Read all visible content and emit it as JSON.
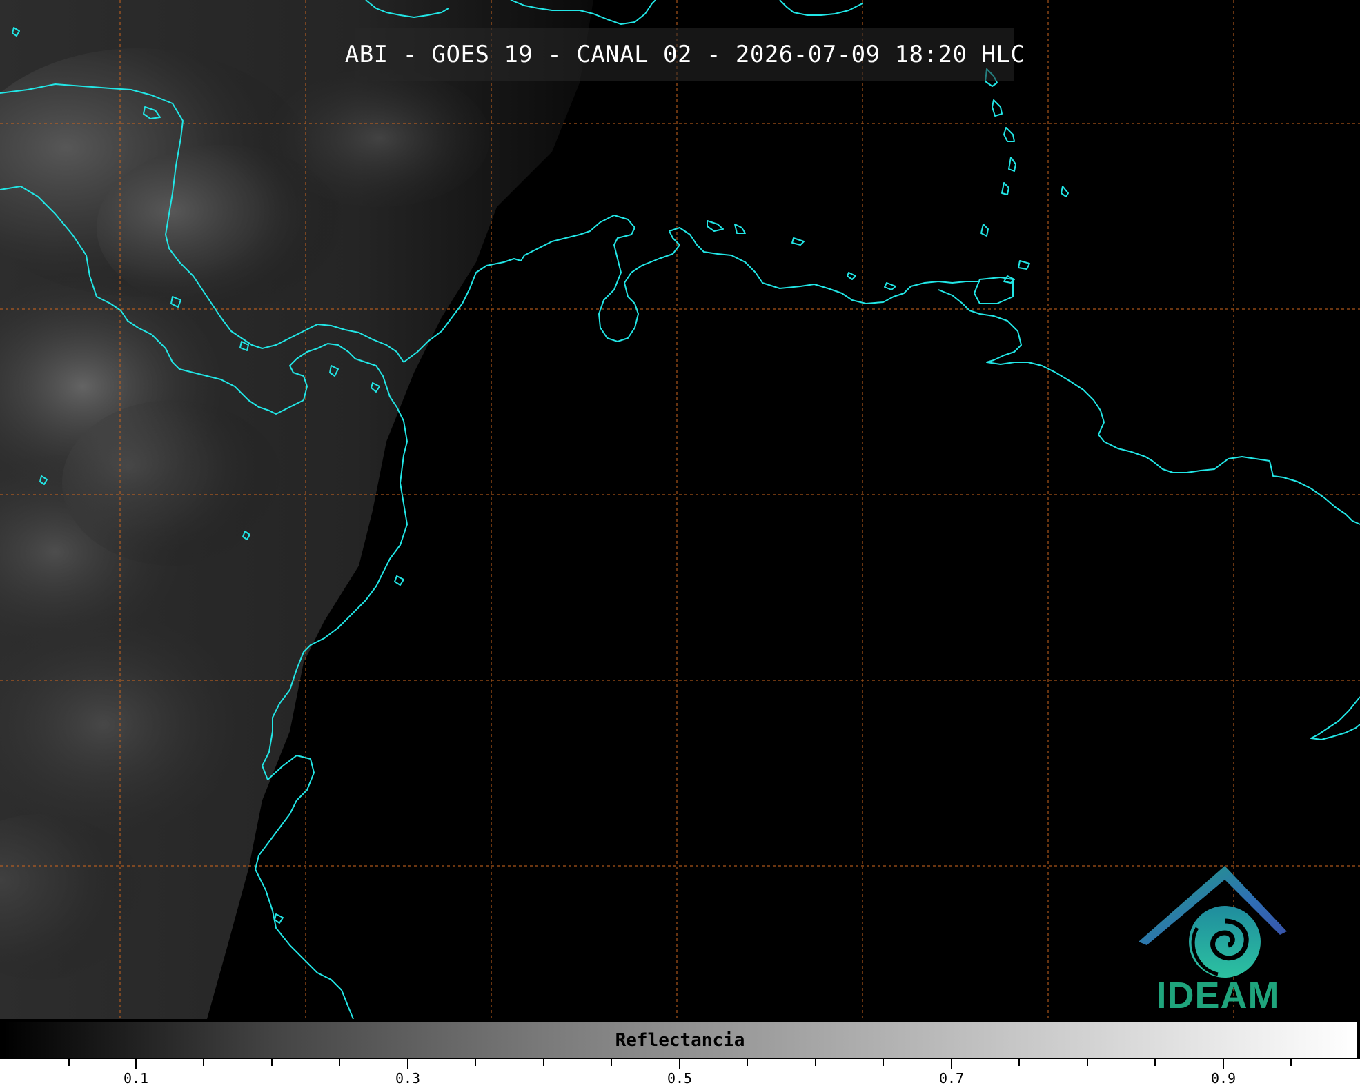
{
  "title": "ABI - GOES 19 - CANAL 02 - 2026-07-09 18:20 HLC",
  "logo_text": "IDEAM",
  "colorbar": {
    "label": "Reflectancia",
    "tick_labels": [
      "0.1",
      "0.3",
      "0.5",
      "0.7",
      "0.9"
    ],
    "range": [
      0.0,
      1.0
    ],
    "colormap": "grayscale"
  },
  "colors": {
    "coastline": "#22e6e6",
    "graticule": "#c8641e",
    "logo_blue": "#2f6fb5",
    "logo_green": "#1fa47c"
  },
  "icons": {
    "logo": "ideam-logo-icon"
  }
}
